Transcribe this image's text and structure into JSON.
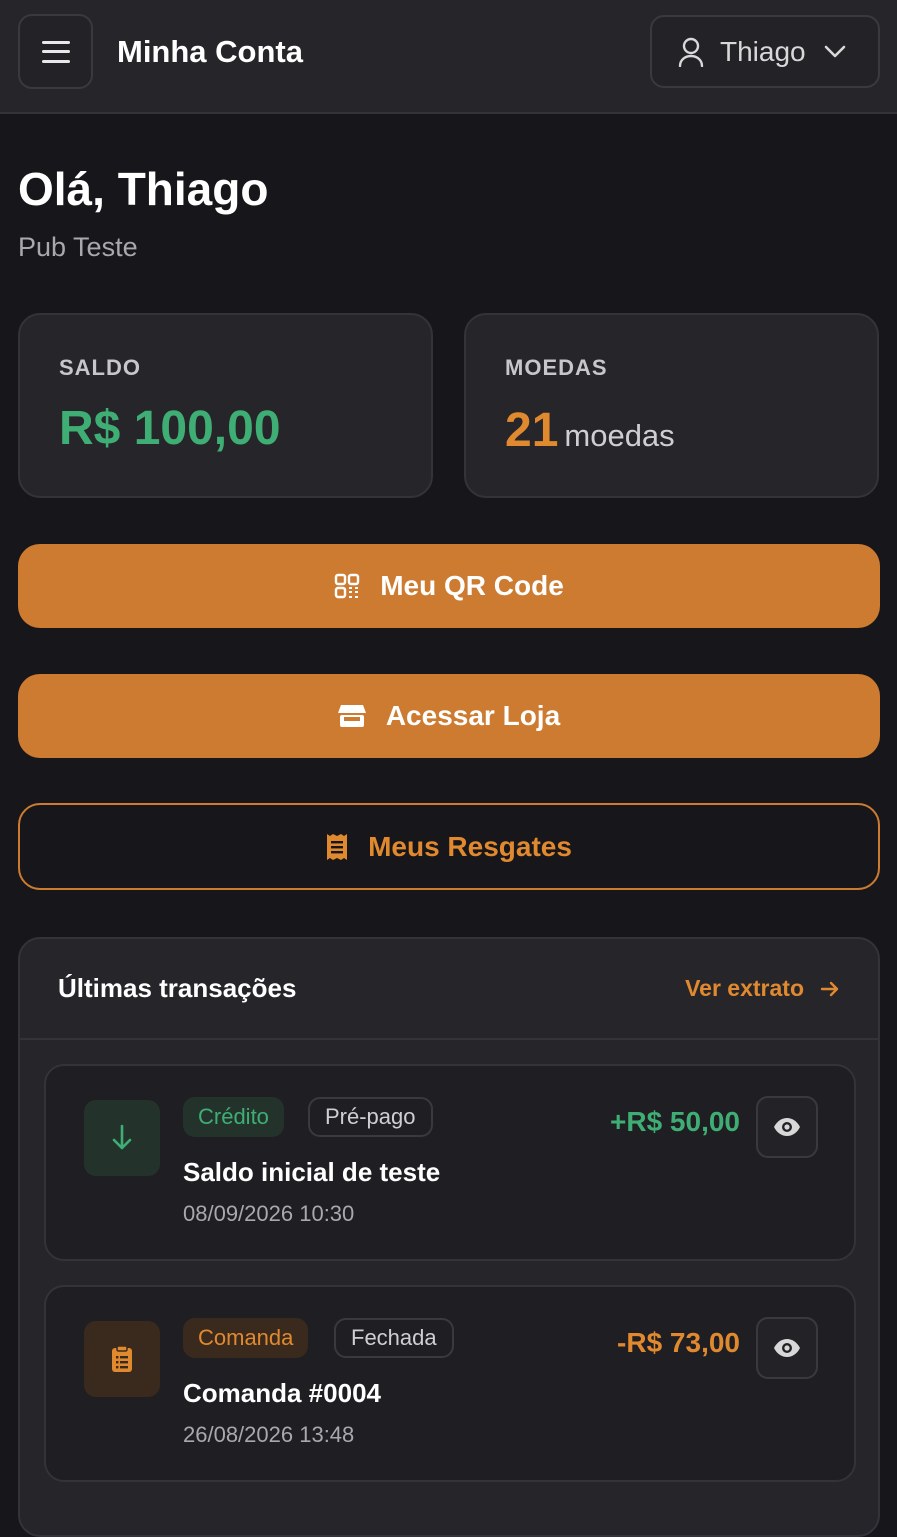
{
  "header": {
    "title": "Minha Conta",
    "user_name": "Thiago"
  },
  "greeting": {
    "title": "Olá, Thiago",
    "venue": "Pub Teste"
  },
  "cards": {
    "balance": {
      "label": "SALDO",
      "value": "R$ 100,00"
    },
    "coins": {
      "label": "MOEDAS",
      "value": "21",
      "unit": "moedas"
    }
  },
  "actions": {
    "qr_code": "Meu QR Code",
    "store": "Acessar Loja",
    "redemptions": "Meus Resgates"
  },
  "transactions": {
    "title": "Últimas transações",
    "view_statement": "Ver extrato",
    "items": [
      {
        "type_tag": "Crédito",
        "status_tag": "Pré-pago",
        "name": "Saldo inicial de teste",
        "date": "08/09/2026 10:30",
        "amount": "+R$ 50,00",
        "icon": "arrow-down-icon"
      },
      {
        "type_tag": "Comanda",
        "status_tag": "Fechada",
        "name": "Comanda #0004",
        "date": "26/08/2026 13:48",
        "amount": "-R$ 73,00",
        "icon": "clipboard-icon"
      }
    ]
  },
  "colors": {
    "background": "#17161b",
    "surface": "#26252a",
    "accent": "#cd7b30",
    "positive": "#3fae74",
    "negative": "#e0892f"
  }
}
